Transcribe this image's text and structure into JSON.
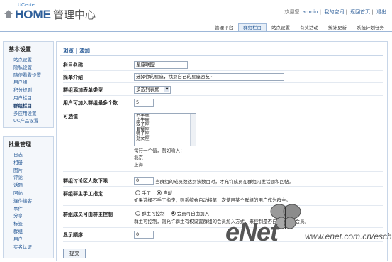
{
  "brand": {
    "ucenter": "UCente",
    "home": "HOME",
    "title": "管理中心"
  },
  "toplinks": [
    "欢迎您",
    "admin",
    "我的空间",
    "返回首页",
    "退出"
  ],
  "nav_tabs": [
    {
      "label": "管理平台",
      "active": false
    },
    {
      "label": "群组栏目",
      "active": true
    },
    {
      "label": "站点设置",
      "active": false
    },
    {
      "label": "有奖活动",
      "active": false
    },
    {
      "label": "统计更新",
      "active": false
    },
    {
      "label": "系统计划任务",
      "active": false
    }
  ],
  "sidebar1": {
    "title": "基本设置",
    "items": [
      {
        "label": "站点设置",
        "current": false
      },
      {
        "label": "隐私设置",
        "current": false
      },
      {
        "label": "随便看看设置",
        "current": false
      },
      {
        "label": "用户组",
        "current": false
      },
      {
        "label": "积分规则",
        "current": false
      },
      {
        "label": "用户栏目",
        "current": false
      },
      {
        "label": "群组栏目",
        "current": true
      },
      {
        "label": "多应用设置",
        "current": false
      },
      {
        "label": "UC产品设置",
        "current": false
      }
    ]
  },
  "sidebar2": {
    "title": "批量管理",
    "items": [
      "日志",
      "相册",
      "图片",
      "评论",
      "话题",
      "回帖",
      "连你接客",
      "事件",
      "分享",
      "标签",
      "群组",
      "用户",
      "实名认证"
    ]
  },
  "form": {
    "breadcrumb": "浏览 | 添加",
    "name_label": "栏目名称",
    "name_value": "星座联盟",
    "intro_label": "简单介绍",
    "intro_value": "选择你的星座，找到自己的星座密友~",
    "type_label": "群组添加表单类型",
    "type_value": "多选列表框",
    "maxjoin_label": "用户可加入群组最多个数",
    "maxjoin_value": "5",
    "options_label": "可选值",
    "options": [
      "白羊座",
      "金牛座",
      "双子座",
      "巨蟹座",
      "狮子座",
      "处女座"
    ],
    "options_hint": "每行一个值，例如输入：",
    "options_example": [
      "北京",
      "上海"
    ],
    "minmembers_label": "群组讨论区人数下限",
    "minmembers_value": "0",
    "minmembers_hint": "当群组的成员数达到该数目时，才允许成员在群组内发话题和回帖。",
    "owner_label": "群组群主手工指定",
    "owner_options": [
      {
        "label": "手工",
        "checked": false
      },
      {
        "label": "自动",
        "checked": true
      }
    ],
    "owner_hint": "如果选择不手工指定，则系统会自动将第一次使用某个群组的用户作为群主。",
    "join_label": "群组成员可由群主控制",
    "join_options": [
      {
        "label": "群主可控制",
        "checked": false
      },
      {
        "label": "会员可自由加入",
        "checked": true
      }
    ],
    "join_hint": "群主可控制，则允许群主有权设置群组的会员加入方式，来控制是否自由加入的会员。",
    "order_label": "显示顺序",
    "order_value": "0",
    "submit_label": "提交"
  },
  "watermark": {
    "brand": "eNet",
    "url": "www.enet.com.cn/eschool"
  }
}
